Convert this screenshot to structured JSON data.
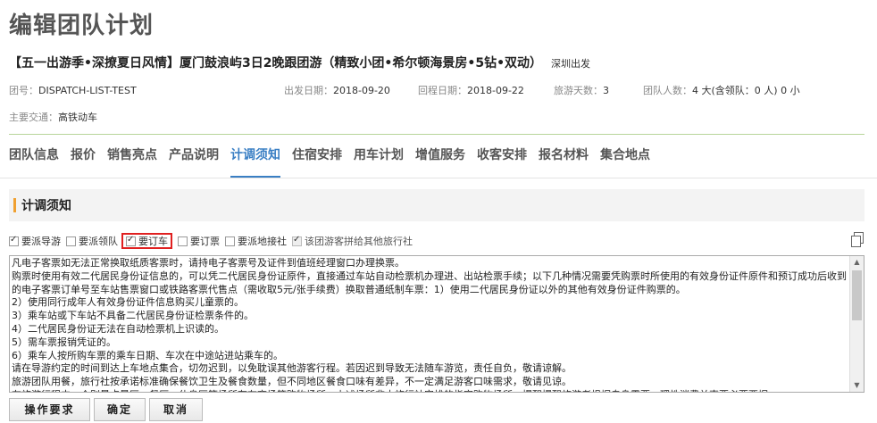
{
  "page": {
    "title": "编辑团队计划",
    "route_title": "【五一出游季•深撩夏日风情】厦门鼓浪屿3日2晚跟团游（精致小团•希尔顿海景房•5钻•双动）",
    "depart": "深圳出发"
  },
  "meta": {
    "team_no_label": "团号：",
    "team_no": "DISPATCH-LIST-TEST",
    "depart_date_label": "出发日期：",
    "depart_date": "2018-09-20",
    "return_date_label": "回程日期：",
    "return_date": "2018-09-22",
    "days_label": "旅游天数：",
    "days": "3",
    "people_label": "团队人数：",
    "people": "4 大(含领队：0 人) 0 小",
    "transport_label": "主要交通：",
    "transport": "高铁动车"
  },
  "tabs": [
    {
      "label": "团队信息"
    },
    {
      "label": "报价"
    },
    {
      "label": "销售亮点"
    },
    {
      "label": "产品说明"
    },
    {
      "label": "计调须知"
    },
    {
      "label": "住宿安排"
    },
    {
      "label": "用车计划"
    },
    {
      "label": "增值服务"
    },
    {
      "label": "收客安排"
    },
    {
      "label": "报名材料"
    },
    {
      "label": "集合地点"
    }
  ],
  "section": {
    "title": "计调须知"
  },
  "checkboxes": [
    {
      "label": "要派导游",
      "checked": true
    },
    {
      "label": "要派领队",
      "checked": false
    },
    {
      "label": "要订车",
      "checked": true
    },
    {
      "label": "要订票",
      "checked": false
    },
    {
      "label": "要派地接社",
      "checked": false
    },
    {
      "label": "该团游客拼给其他旅行社",
      "checked": true
    }
  ],
  "notes": "凡电子客票如无法正常换取纸质客票时，请持电子客票号及证件到值班经理窗口办理换票。\n购票时使用有效二代居民身份证信息的，可以凭二代居民身份证原件，直接通过车站自动检票机办理进、出站检票手续；以下几种情况需要凭购票时所使用的有效身份证件原件和预订成功后收到的电子客票订单号至车站售票窗口或铁路客票代售点（需收取5元/张手续费）换取普通纸制车票：1）使用二代居民身份证以外的其他有效身份证件购票的。\n2）使用同行成年人有效身份证件信息购买儿童票的。\n3）乘车站或下车站不具备二代居民身份证检票条件的。\n4）二代居民身份证无法在自动检票机上识读的。\n5）需车票报销凭证的。\n6）乘车人按所购车票的乘车日期、车次在中途站进站乘车的。\n请在导游约定的时间到达上车地点集合，切勿迟到，以免耽误其他游客行程。若因迟到导致无法随车游览，责任自负，敬请谅解。\n旅游团队用餐，旅行社按承诺标准确保餐饮卫生及餐食数量，但不同地区餐食口味有差异，不一定满足游客口味需求，敬请见谅。\n在旅游行程中，个别景点景区、餐厅、休息区等场所存在商场等购物场所，上述场所非本旅行社安排的指定购物场所。提醒提醒旅游者根据自身需要，理性消费并索要必要票据。\n                                                          中出游带的了票，敬请谅解。",
  "buttons": {
    "requirements": "操作要求",
    "confirm": "确定",
    "cancel": "取消"
  }
}
